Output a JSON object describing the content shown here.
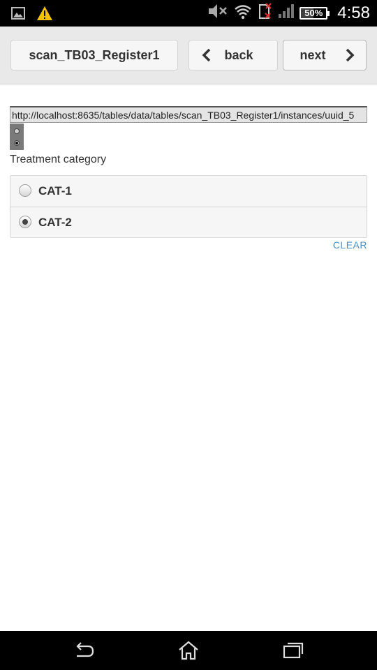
{
  "status_bar": {
    "time": "4:58",
    "battery_percent": 50,
    "battery_label": "50%",
    "icons_left": [
      "gallery-icon",
      "warning-icon"
    ],
    "icons_right": [
      "mute-icon",
      "wifi-icon",
      "sim-missing-icon",
      "signal-icon",
      "battery-icon"
    ]
  },
  "toolbar": {
    "title_label": "scan_TB03_Register1",
    "back_label": "back",
    "next_label": "next"
  },
  "form": {
    "url_value": "http://localhost:8635/tables/data/tables/scan_TB03_Register1/instances/uuid_5",
    "question_label": "Treatment category",
    "options": [
      {
        "label": "CAT-1",
        "selected": false
      },
      {
        "label": "CAT-2",
        "selected": true
      }
    ],
    "clear_label": "CLEAR"
  },
  "colors": {
    "accent_link": "#4a90c8",
    "toolbar_bg": "#e9e9e9",
    "warning": "#f2c200"
  }
}
